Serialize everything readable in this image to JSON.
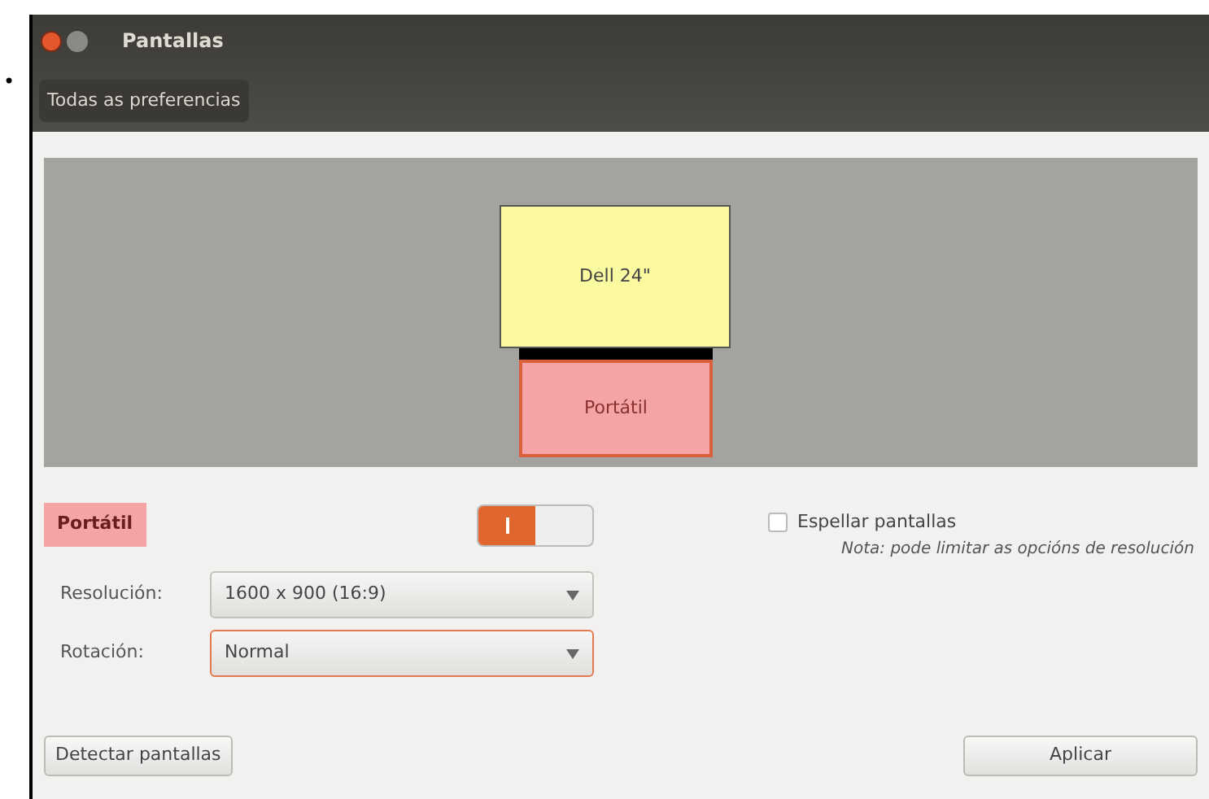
{
  "bullet": "•",
  "window": {
    "title": "Pantallas"
  },
  "toolbar": {
    "button": "Todas as preferencias"
  },
  "monitors": [
    {
      "name": "Dell 24\"",
      "color": "#fbfaa0",
      "selected": false
    },
    {
      "name": "Portátil",
      "color": "#f4a4a4",
      "selected": true
    }
  ],
  "display": {
    "name": "Portátil",
    "on": true
  },
  "mirror": {
    "label": "Espellar pantallas",
    "checked": false,
    "note": "Nota: pode limitar as opcións de resolución"
  },
  "fields": [
    {
      "label": "Resolución:",
      "value": "1600 x 900 (16:9)",
      "focused": false
    },
    {
      "label": "Rotación:",
      "value": "Normal",
      "focused": true
    }
  ],
  "buttons": {
    "detect": "Detectar pantallas",
    "apply": "Aplicar"
  }
}
